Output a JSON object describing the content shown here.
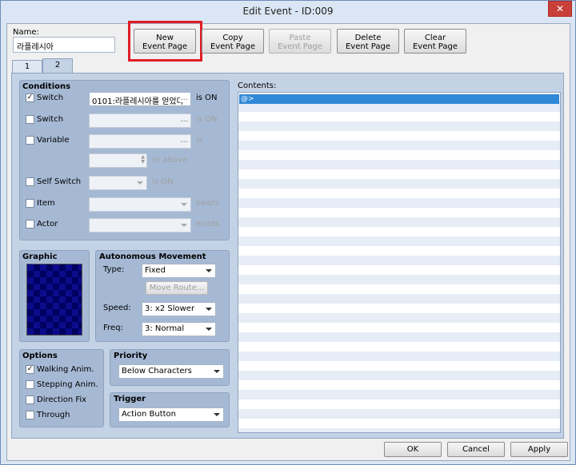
{
  "window": {
    "title": "Edit Event - ID:009",
    "close_glyph": "✕"
  },
  "name": {
    "label": "Name:",
    "value": "라플레시아"
  },
  "toolbar": {
    "new_page": [
      "New",
      "Event Page"
    ],
    "copy_page": [
      "Copy",
      "Event Page"
    ],
    "paste_page": [
      "Paste",
      "Event Page"
    ],
    "delete_page": [
      "Delete",
      "Event Page"
    ],
    "clear_page": [
      "Clear",
      "Event Page"
    ]
  },
  "tabs": [
    "1",
    "2"
  ],
  "conditions": {
    "title": "Conditions",
    "switch1": {
      "label": "Switch",
      "checked": true,
      "check_glyph": "✓",
      "value": "0101:라플레시아를 얻었다",
      "suffix": "is ON"
    },
    "switch2": {
      "label": "Switch",
      "value": "",
      "suffix": "is ON"
    },
    "variable": {
      "label": "Variable",
      "value": "",
      "suffix": "is",
      "suffix2": "or above"
    },
    "self_switch": {
      "label": "Self Switch",
      "value": "",
      "suffix": "is ON"
    },
    "item": {
      "label": "Item",
      "value": "",
      "suffix": "exists"
    },
    "actor": {
      "label": "Actor",
      "value": "",
      "suffix": "exists"
    },
    "ellipsis": "..."
  },
  "graphic": {
    "title": "Graphic"
  },
  "autonomous": {
    "title": "Autonomous Movement",
    "type_label": "Type:",
    "type_value": "Fixed",
    "move_route": "Move Route...",
    "speed_label": "Speed:",
    "speed_value": "3: x2 Slower",
    "freq_label": "Freq:",
    "freq_value": "3: Normal"
  },
  "options": {
    "title": "Options",
    "items": [
      {
        "label": "Walking Anim.",
        "checked": true
      },
      {
        "label": "Stepping Anim.",
        "checked": false
      },
      {
        "label": "Direction Fix",
        "checked": false
      },
      {
        "label": "Through",
        "checked": false
      }
    ],
    "check_glyph": "✓"
  },
  "priority": {
    "title": "Priority",
    "value": "Below Characters"
  },
  "trigger": {
    "title": "Trigger",
    "value": "Action Button"
  },
  "contents": {
    "label": "Contents:",
    "first_row": "@>"
  },
  "footer": {
    "ok": "OK",
    "cancel": "Cancel",
    "apply": "Apply"
  }
}
